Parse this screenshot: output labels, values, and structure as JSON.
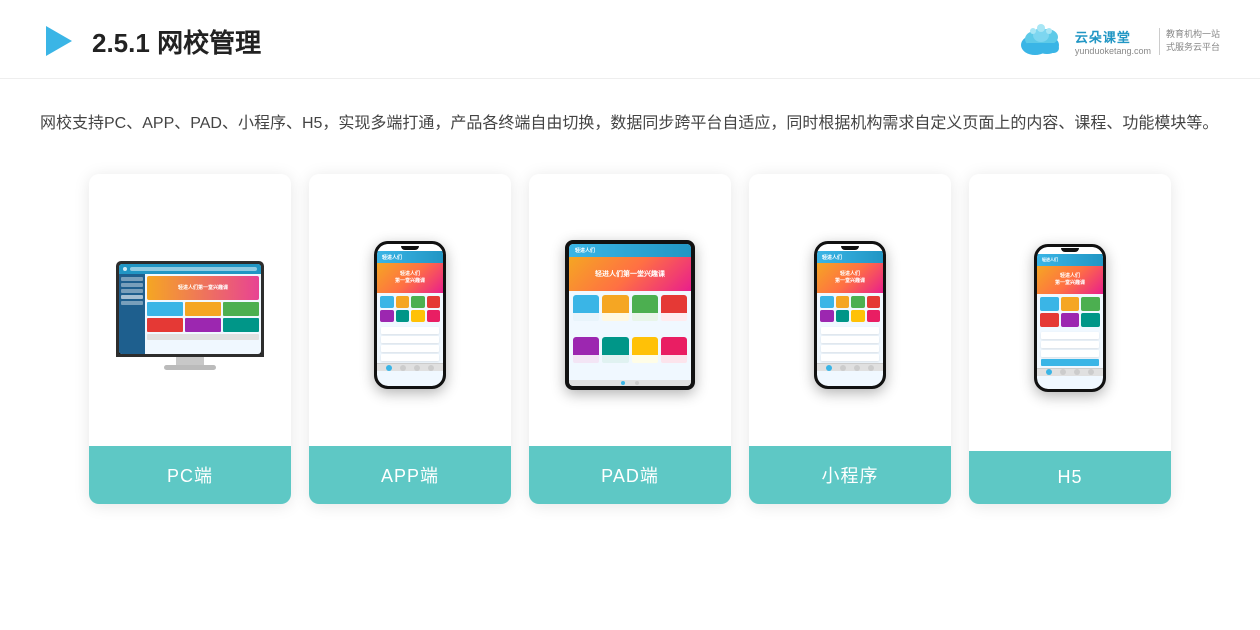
{
  "header": {
    "title_prefix": "2.5.1 ",
    "title_main": "网校管理",
    "brand": {
      "name": "云朵课堂",
      "url": "yunduoketang.com",
      "tagline_line1": "教育机构一站",
      "tagline_line2": "式服务云平台"
    }
  },
  "description": {
    "text": "网校支持PC、APP、PAD、小程序、H5，实现多端打通，产品各终端自由切换，数据同步跨平台自适应，同时根据机构需求自定义页面上的内容、课程、功能模块等。"
  },
  "cards": [
    {
      "id": "pc",
      "label": "PC端"
    },
    {
      "id": "app",
      "label": "APP端"
    },
    {
      "id": "pad",
      "label": "PAD端"
    },
    {
      "id": "miniapp",
      "label": "小程序"
    },
    {
      "id": "h5",
      "label": "H5"
    }
  ]
}
